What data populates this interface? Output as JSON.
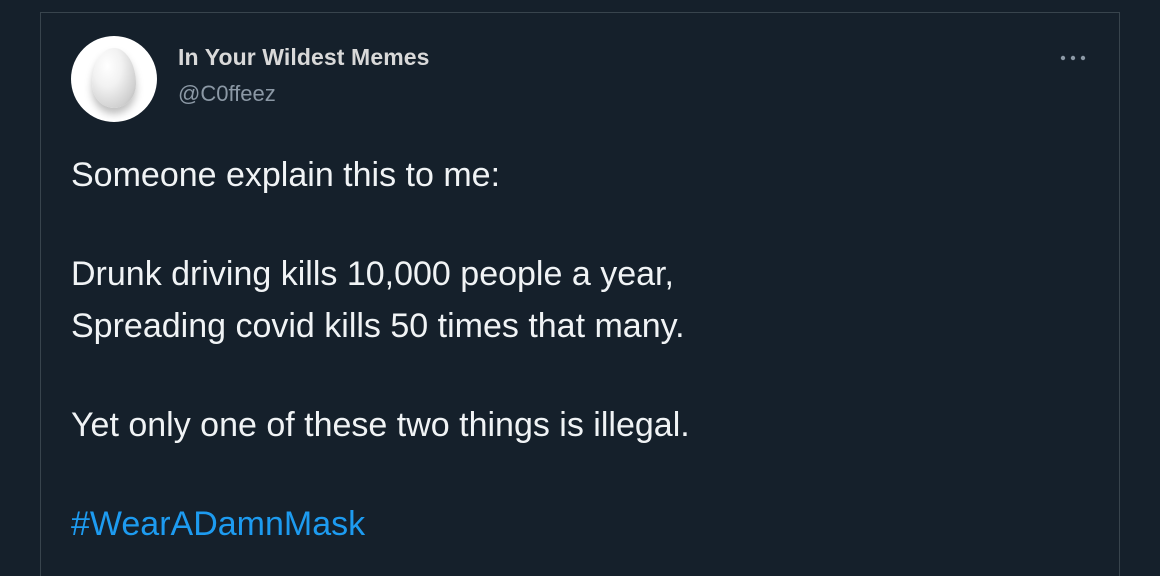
{
  "author": {
    "display_name": "In Your Wildest Memes",
    "handle": "@C0ffeez",
    "avatar_icon": "egg-avatar-icon"
  },
  "menu": {
    "icon": "more-horizontal-icon"
  },
  "tweet": {
    "line1": "Someone explain this to me:",
    "line2": "Drunk driving kills 10,000 people a year,",
    "line3": "Spreading covid kills 50 times that many.",
    "line4": "Yet only one of these two things is illegal.",
    "hashtag": "#WearADamnMask"
  },
  "colors": {
    "background": "#15202b",
    "border": "#38444d",
    "text": "#f0f3f5",
    "secondary_text": "#8b98a5",
    "link": "#1d9bf0"
  }
}
